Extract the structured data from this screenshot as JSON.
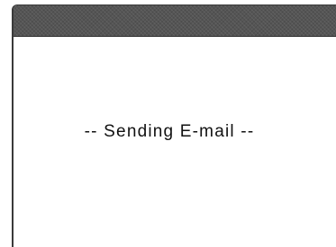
{
  "dialog": {
    "title": "",
    "status_message": "-- Sending E-mail --"
  },
  "colors": {
    "title_bar": "#555555",
    "background": "#ffffff",
    "text": "#111111"
  }
}
